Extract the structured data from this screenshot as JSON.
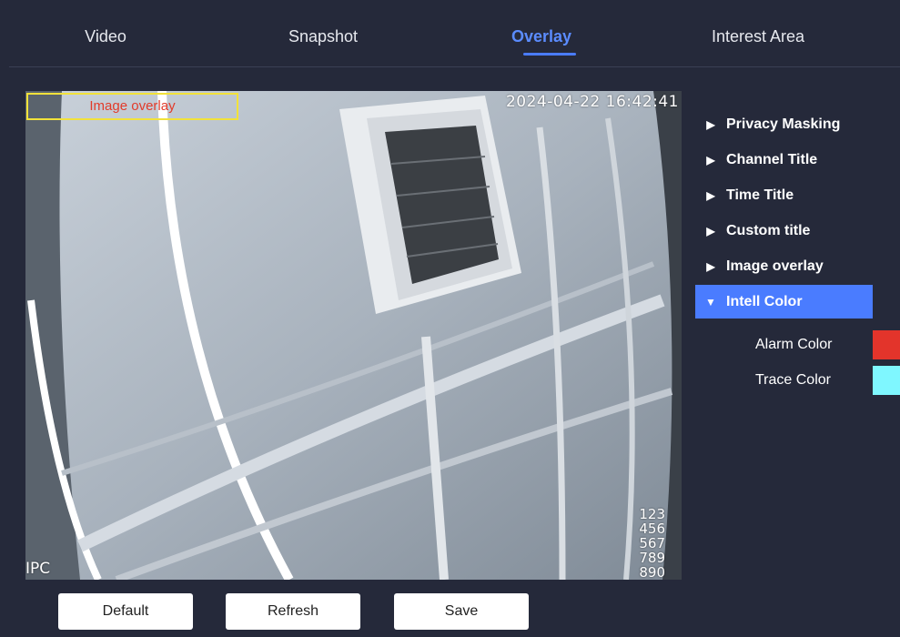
{
  "tabs": [
    {
      "label": "Video"
    },
    {
      "label": "Snapshot"
    },
    {
      "label": "Overlay"
    },
    {
      "label": "Interest Area"
    }
  ],
  "active_tab": "Overlay",
  "preview": {
    "timestamp": "2024-04-22 16:42:41",
    "image_overlay_label": "Image overlay",
    "channel_title": "IPC",
    "custom_lines": [
      "123",
      "456",
      "567",
      "789",
      "890"
    ]
  },
  "menu": {
    "items": [
      {
        "label": "Privacy Masking"
      },
      {
        "label": "Channel Title"
      },
      {
        "label": "Time Title"
      },
      {
        "label": "Custom title"
      },
      {
        "label": "Image overlay"
      },
      {
        "label": "Intell Color"
      }
    ],
    "expanded": "Intell Color"
  },
  "intell_color": {
    "alarm_label": "Alarm Color",
    "alarm_color": "#e3342b",
    "trace_label": "Trace Color",
    "trace_color": "#7ff7ff"
  },
  "buttons": {
    "default_label": "Default",
    "refresh_label": "Refresh",
    "save_label": "Save"
  }
}
